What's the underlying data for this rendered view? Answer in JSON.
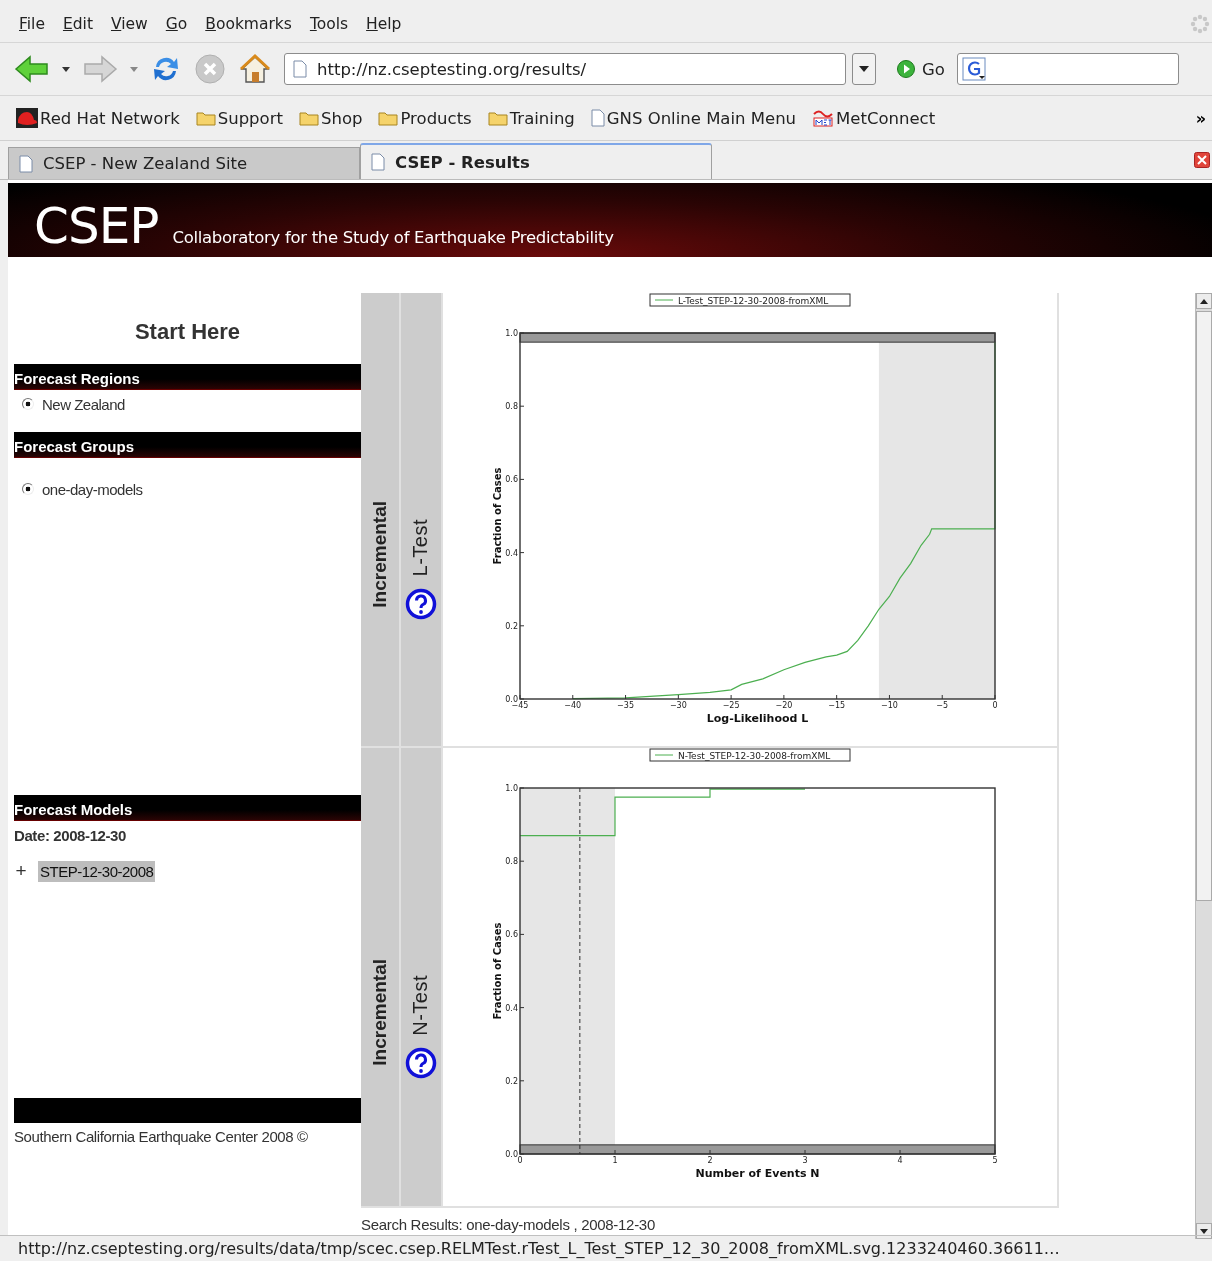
{
  "menu_bar": [
    "File",
    "Edit",
    "View",
    "Go",
    "Bookmarks",
    "Tools",
    "Help"
  ],
  "navigation": {
    "url": "http://nz.cseptesting.org/results/",
    "go_label": "Go"
  },
  "bookmarks": [
    {
      "label": "Red Hat Network",
      "kind": "redhat"
    },
    {
      "label": "Support",
      "kind": "folder"
    },
    {
      "label": "Shop",
      "kind": "folder"
    },
    {
      "label": "Products",
      "kind": "folder"
    },
    {
      "label": "Training",
      "kind": "folder"
    },
    {
      "label": "GNS Online Main Menu",
      "kind": "page"
    },
    {
      "label": "MetConnect",
      "kind": "met"
    }
  ],
  "bookmarks_overflow": "»",
  "tabs": [
    {
      "label": "CSEP - New Zealand Site",
      "selected": false
    },
    {
      "label": "CSEP - Results",
      "selected": true
    }
  ],
  "banner": {
    "logo": "CSEP",
    "subtitle": "Collaboratory for the Study of Earthquake Predictability"
  },
  "sidebar": {
    "title": "Start Here",
    "sections": [
      {
        "heading": "Forecast Regions",
        "kind": "radio_list",
        "items": [
          {
            "label": "New Zealand",
            "selected": true
          }
        ]
      },
      {
        "heading": "Forecast Groups",
        "kind": "radio_list",
        "items": [
          {
            "label": "one-day-models",
            "selected": true
          }
        ]
      },
      {
        "heading": "Forecast Models",
        "kind": "tree",
        "date": "Date: 2008-12-30",
        "items": [
          {
            "label": "STEP-12-30-2008",
            "expander": "+",
            "selected": true
          }
        ]
      }
    ],
    "footer": "Southern California Earthquake Center 2008 ©"
  },
  "results": [
    {
      "group_label": "Incremental",
      "test_label": "L-Test",
      "chart_data": {
        "type": "line",
        "xlabel": "Log-Likelihood L",
        "ylabel": "Fraction of Cases",
        "x": [
          -40,
          -35,
          -30,
          -27,
          -25,
          -24,
          -22,
          -20,
          -18,
          -16,
          -15,
          -14,
          -13,
          -12,
          -11,
          -10,
          -9,
          -8,
          -7,
          -6.2,
          -6,
          0,
          0
        ],
        "series": [
          {
            "name": "L-Test_STEP-12-30-2008-fromXML",
            "color": "#4caf50",
            "values": [
              0.001,
              0.003,
              0.012,
              0.018,
              0.025,
              0.04,
              0.055,
              0.08,
              0.1,
              0.115,
              0.12,
              0.13,
              0.16,
              0.2,
              0.245,
              0.28,
              0.33,
              0.37,
              0.42,
              0.45,
              0.465,
              0.465,
              0.975
            ]
          }
        ],
        "xlim": [
          -45,
          0
        ],
        "ylim": [
          0,
          1
        ],
        "xticks": [
          {
            "value": -45,
            "label": "−45"
          },
          {
            "value": -40,
            "label": "−40"
          },
          {
            "value": -35,
            "label": "−35"
          },
          {
            "value": -30,
            "label": "−30"
          },
          {
            "value": -25,
            "label": "−25"
          },
          {
            "value": -20,
            "label": "−20"
          },
          {
            "value": -15,
            "label": "−15"
          },
          {
            "value": -10,
            "label": "−10"
          },
          {
            "value": -5,
            "label": "−5"
          },
          {
            "value": 0,
            "label": "0"
          }
        ],
        "yticks": [
          {
            "value": 0,
            "label": "0.0"
          },
          {
            "value": 0.2,
            "label": "0.2"
          },
          {
            "value": 0.4,
            "label": "0.4"
          },
          {
            "value": 0.6,
            "label": "0.6"
          },
          {
            "value": 0.8,
            "label": "0.8"
          },
          {
            "value": 1,
            "label": "1.0"
          }
        ],
        "bands": [
          {
            "axis": "x",
            "from": -11,
            "to": 0,
            "color": "#e6e6e6"
          },
          {
            "axis": "y",
            "from": 0.975,
            "to": 1,
            "color": "#999999"
          }
        ]
      }
    },
    {
      "group_label": "Incremental",
      "test_label": "N-Test",
      "chart_data": {
        "type": "line",
        "xlabel": "Number of Events N",
        "ylabel": "Fraction of Cases",
        "x": [
          0,
          1,
          1,
          2,
          2,
          3
        ],
        "series": [
          {
            "name": "N-Test_STEP-12-30-2008-fromXML",
            "color": "#4caf50",
            "values": [
              0.87,
              0.87,
              0.975,
              0.975,
              0.997,
              0.997
            ]
          }
        ],
        "xlim": [
          0,
          5
        ],
        "ylim": [
          0,
          1
        ],
        "xticks": [
          0,
          1,
          2,
          3,
          4,
          5
        ],
        "yticks": [
          {
            "value": 0,
            "label": "0.0"
          },
          {
            "value": 0.2,
            "label": "0.2"
          },
          {
            "value": 0.4,
            "label": "0.4"
          },
          {
            "value": 0.6,
            "label": "0.6"
          },
          {
            "value": 0.8,
            "label": "0.8"
          },
          {
            "value": 1,
            "label": "1.0"
          }
        ],
        "bands": [
          {
            "axis": "x",
            "from": 0,
            "to": 1,
            "color": "#e6e6e6"
          },
          {
            "axis": "y",
            "from": 0,
            "to": 0.025,
            "color": "#999999"
          }
        ],
        "ref_lines": [
          {
            "axis": "x",
            "value": 0.63,
            "color": "#333333"
          }
        ]
      }
    }
  ],
  "search_results": "Search Results: one-day-models , 2008-12-30",
  "status_bar": "http://nz.cseptesting.org/results/data/tmp/scec.csep.RELMTest.rTest_L_Test_STEP_12_30_2008_fromXML.svg.1233240460.36611…"
}
